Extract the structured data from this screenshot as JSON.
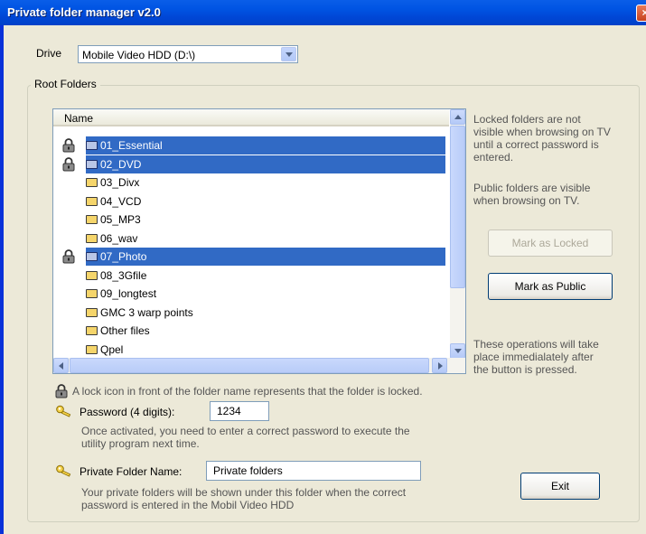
{
  "window": {
    "title": "Private folder manager v2.0",
    "close_glyph": "×"
  },
  "drive": {
    "label": "Drive",
    "selected": "Mobile Video HDD (D:\\)"
  },
  "group": {
    "title": "Root Folders"
  },
  "list": {
    "column_header": "Name",
    "rows": [
      {
        "name": "01_Essential",
        "locked": true,
        "selected": true
      },
      {
        "name": "02_DVD",
        "locked": true,
        "selected": true
      },
      {
        "name": "03_Divx",
        "locked": false,
        "selected": false
      },
      {
        "name": "04_VCD",
        "locked": false,
        "selected": false
      },
      {
        "name": "05_MP3",
        "locked": false,
        "selected": false
      },
      {
        "name": "06_wav",
        "locked": false,
        "selected": false
      },
      {
        "name": "07_Photo",
        "locked": true,
        "selected": true
      },
      {
        "name": "08_3Gfile",
        "locked": false,
        "selected": false
      },
      {
        "name": "09_longtest",
        "locked": false,
        "selected": false
      },
      {
        "name": "GMC 3 warp points",
        "locked": false,
        "selected": false
      },
      {
        "name": "Other files",
        "locked": false,
        "selected": false
      },
      {
        "name": "Qpel",
        "locked": false,
        "selected": false
      }
    ]
  },
  "info": {
    "locked_text": [
      "Locked folders are not",
      "visible when browsing on TV",
      "until a correct password is",
      "entered."
    ],
    "public_text": [
      "Public folders are visible",
      "when browsing on TV."
    ],
    "operations_text": [
      "These operations will take",
      "place immedialately after",
      "the button is pressed."
    ]
  },
  "buttons": {
    "mark_locked": "Mark as Locked",
    "mark_public": "Mark as Public",
    "exit": "Exit"
  },
  "lock_note": "A lock icon in front of the folder name represents that the folder is locked.",
  "password": {
    "label": "Password (4 digits):",
    "value": "1234",
    "note_lines": [
      "Once activated, you need to enter a correct password to execute the",
      "utility program next time."
    ]
  },
  "private_folder": {
    "label": "Private Folder Name:",
    "value": "Private folders",
    "note_lines": [
      "Your private folders will be shown under this folder when the correct",
      "password is entered in the Mobil Video HDD"
    ]
  },
  "colors": {
    "titlebar": "#0054e3",
    "selection": "#316ac5",
    "dialog_bg": "#ece9d8"
  },
  "icons": {
    "lock": "padlock-icon",
    "key": "key-icon",
    "folder": "folder-icon"
  }
}
